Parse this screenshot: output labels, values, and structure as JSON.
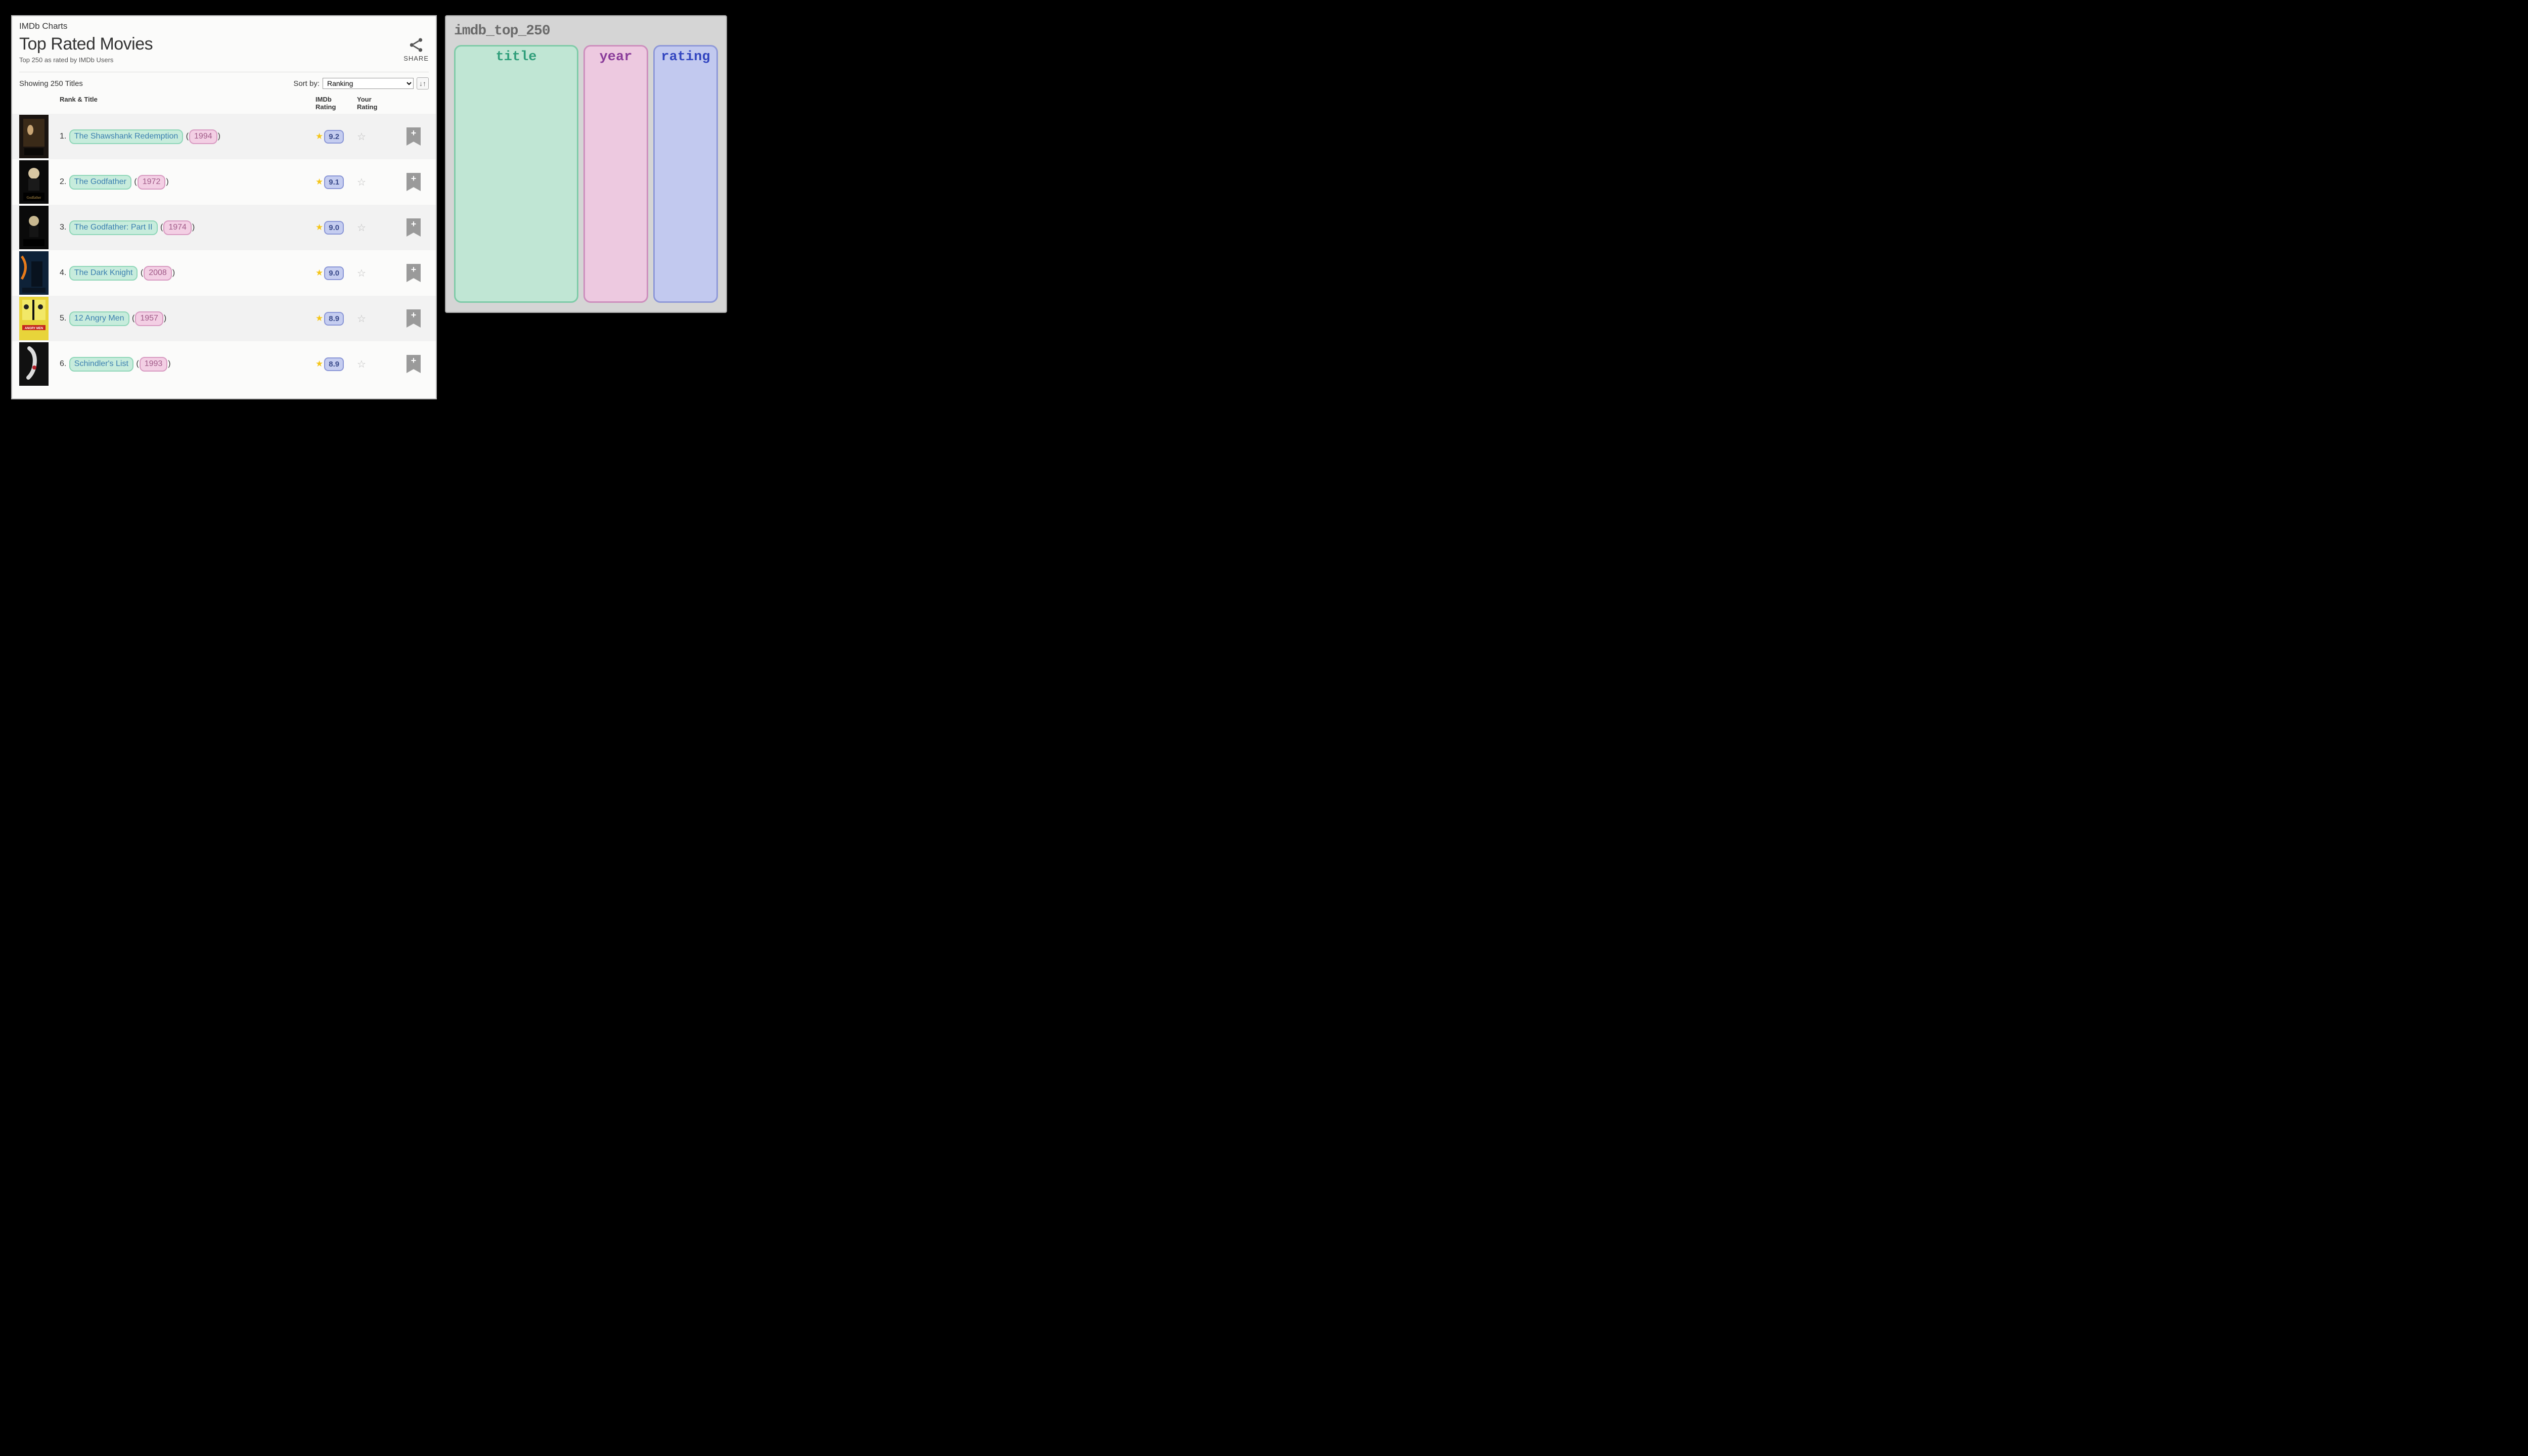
{
  "imdb": {
    "charts_label": "IMDb Charts",
    "title": "Top Rated Movies",
    "subtitle": "Top 250 as rated by IMDb Users",
    "share_label": "SHARE",
    "showing": "Showing 250 Titles",
    "sort_label": "Sort by:",
    "sort_selected": "Ranking",
    "columns": {
      "rank_title": "Rank & Title",
      "imdb_rating": "IMDb Rating",
      "your_rating": "Your Rating"
    },
    "movies": [
      {
        "rank": "1",
        "title": "The Shawshank Redemption",
        "year": "1994",
        "rating": "9.2"
      },
      {
        "rank": "2",
        "title": "The Godfather",
        "year": "1972",
        "rating": "9.1"
      },
      {
        "rank": "3",
        "title": "The Godfather: Part II",
        "year": "1974",
        "rating": "9.0"
      },
      {
        "rank": "4",
        "title": "The Dark Knight",
        "year": "2008",
        "rating": "9.0"
      },
      {
        "rank": "5",
        "title": "12 Angry Men",
        "year": "1957",
        "rating": "8.9"
      },
      {
        "rank": "6",
        "title": "Schindler's List",
        "year": "1993",
        "rating": "8.9"
      }
    ]
  },
  "dataframe": {
    "name": "imdb_top_250",
    "columns": [
      "title",
      "year",
      "rating"
    ]
  },
  "colors": {
    "title_hl": "#c7ecdc",
    "year_hl": "#f3cfe4",
    "rating_hl": "#c5cdf0"
  }
}
